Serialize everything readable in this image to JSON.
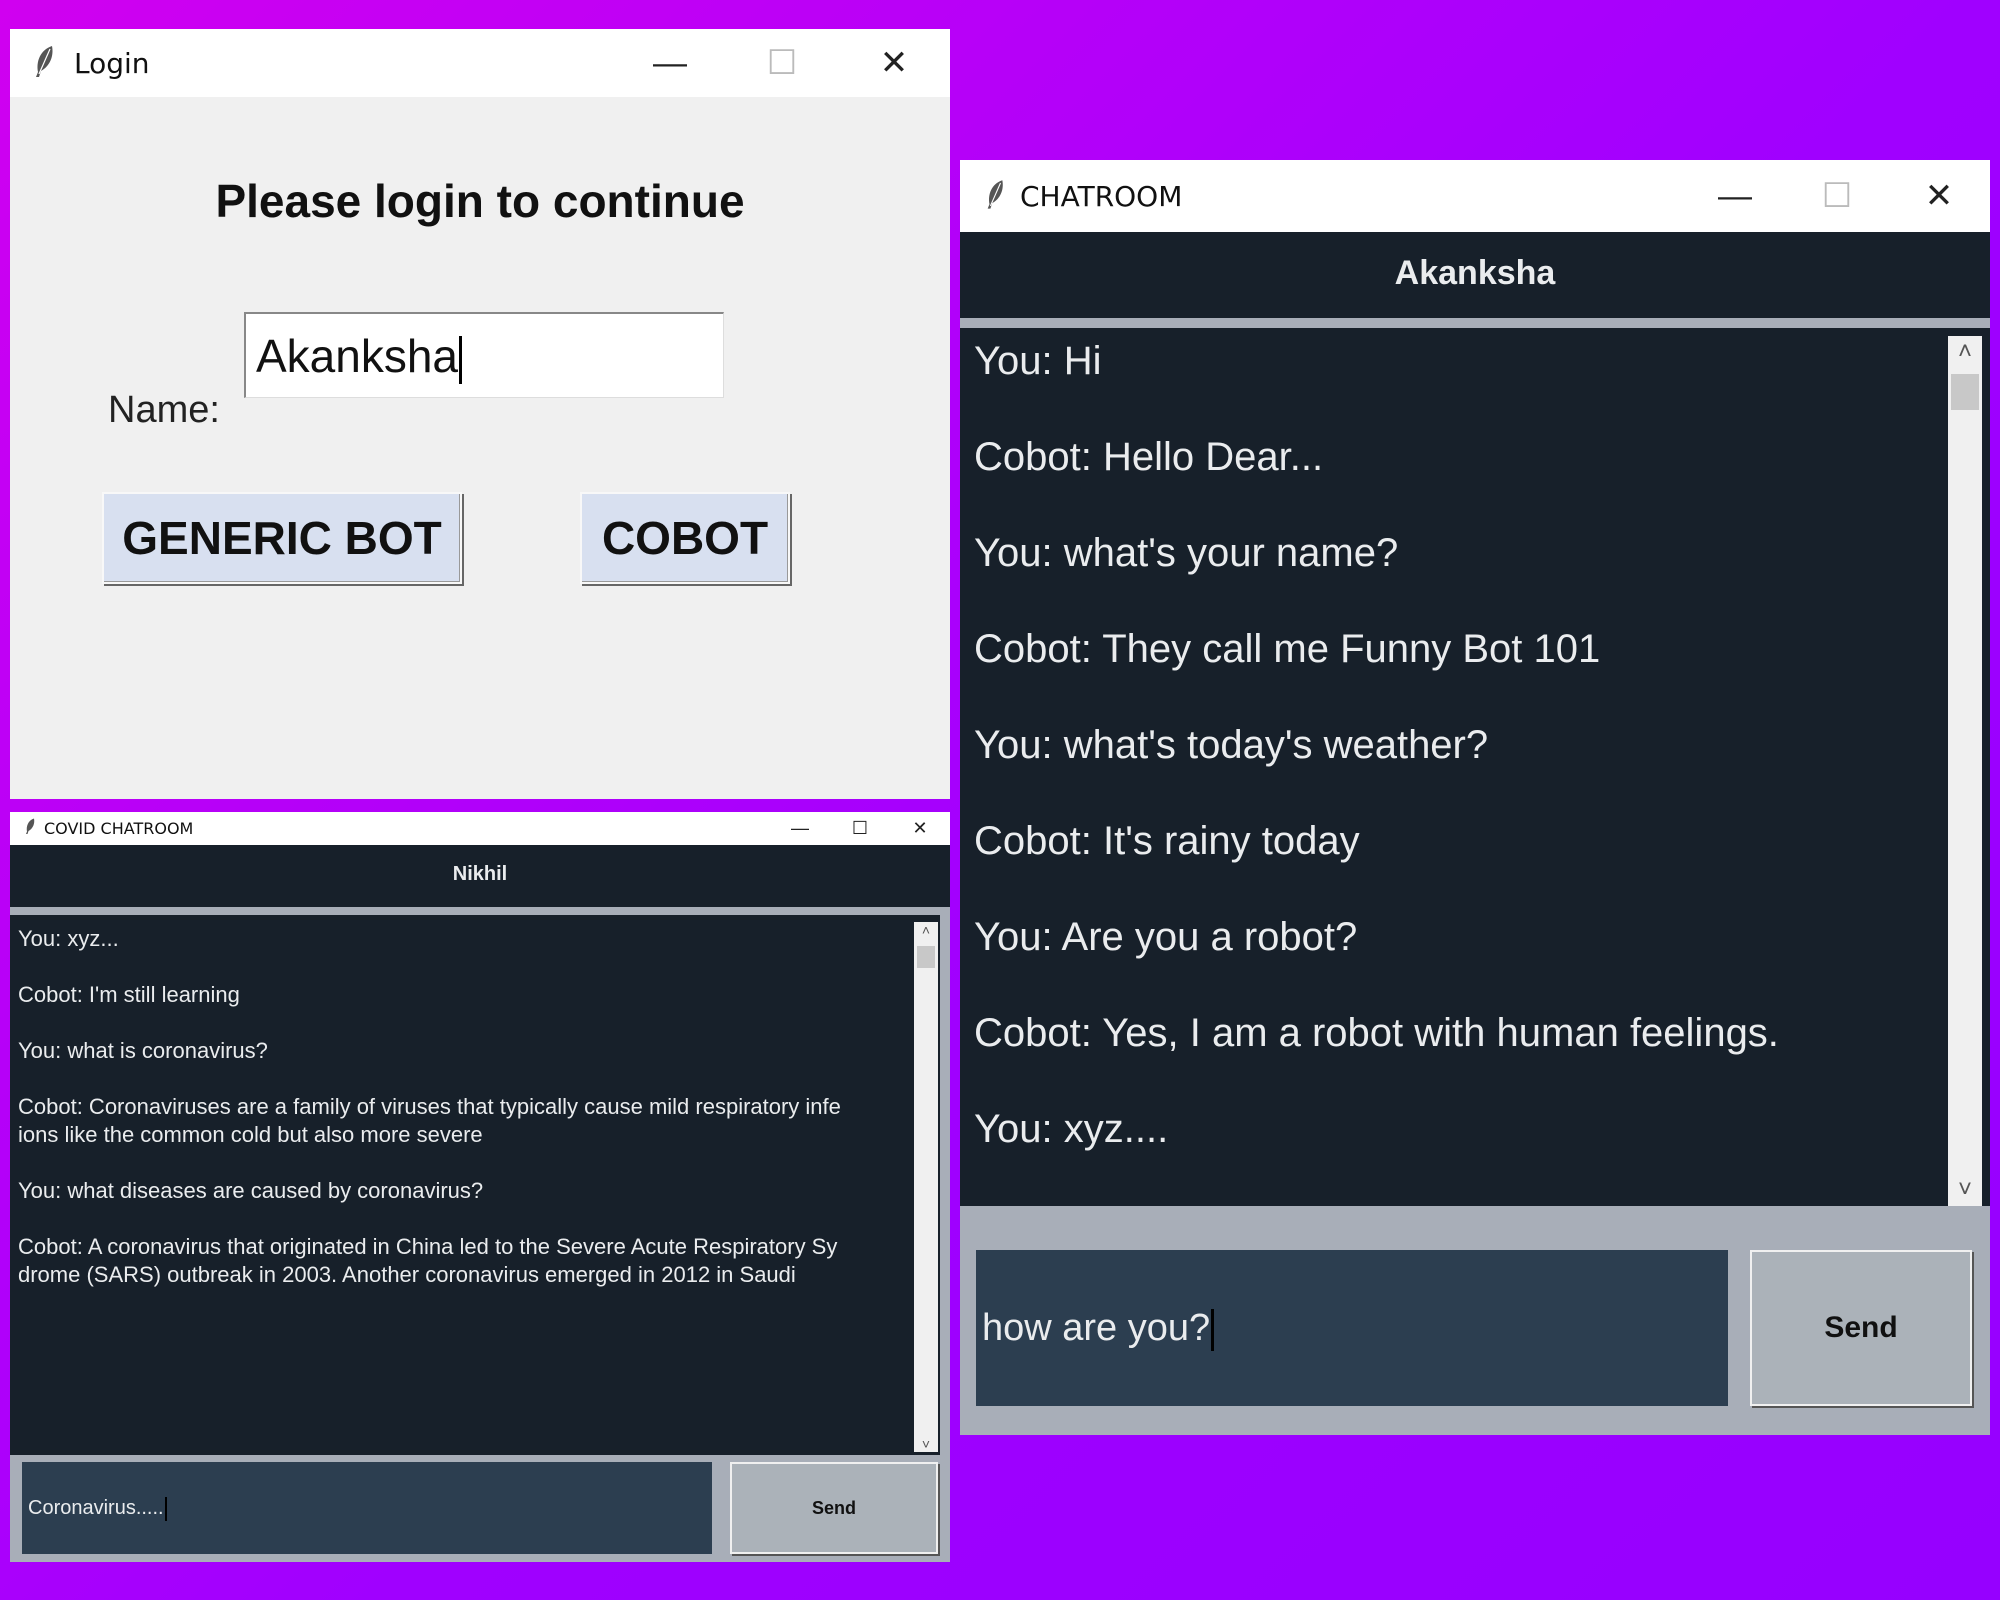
{
  "login_window": {
    "title": "Login",
    "heading": "Please login to continue",
    "name_label": "Name:",
    "name_value": "Akanksha",
    "generic_bot_label": "GENERIC BOT",
    "cobot_label": "COBOT"
  },
  "covid_window": {
    "title": "COVID CHATROOM",
    "user": "Nikhil",
    "messages": [
      "You: xyz...",
      "Cobot: I'm still learning",
      "You: what is coronavirus?",
      "Cobot: Coronaviruses are a family of viruses that typically cause mild respiratory infe\nions like the common cold but also more severe",
      "You: what diseases are caused by coronavirus?",
      "Cobot: A coronavirus that originated in China led to the Severe Acute Respiratory Sy\ndrome (SARS) outbreak in 2003. Another coronavirus emerged in 2012 in Saudi"
    ],
    "input_value": "Coronavirus.....",
    "send_label": "Send"
  },
  "chatroom_window": {
    "title": "CHATROOM",
    "user": "Akanksha",
    "messages": [
      "You: Hi",
      "Cobot: Hello Dear...",
      "You: what's your name?",
      "Cobot: They call me Funny Bot 101",
      "You: what's today's weather?",
      "Cobot: It's rainy today",
      "You: Are you a robot?",
      "Cobot: Yes, I am a robot with human feelings.",
      "You: xyz...."
    ],
    "input_value": "how are you?",
    "send_label": "Send"
  },
  "icons": {
    "app_icon": "feather-icon",
    "minimize": "minimize-icon",
    "maximize": "maximize-icon",
    "close": "close-icon"
  },
  "colors": {
    "background_magenta": "#d000f0",
    "background_purple": "#a000ff",
    "chat_bg": "#17202a",
    "entry_bg": "#2c3e50",
    "send_bg": "#abb2b9",
    "button_bg": "#d8e0f0"
  }
}
